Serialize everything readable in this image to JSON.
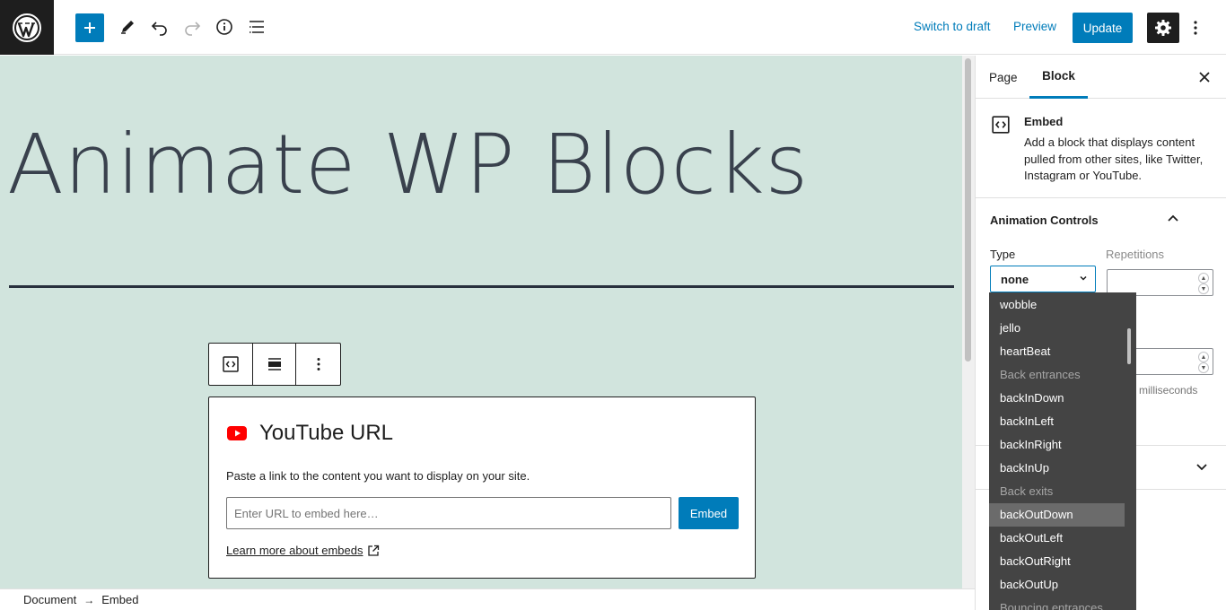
{
  "topbar": {
    "switch_to_draft": "Switch to draft",
    "preview": "Preview",
    "update": "Update"
  },
  "canvas": {
    "title": "Animate WP Blocks"
  },
  "embed": {
    "title": "YouTube URL",
    "instructions": "Paste a link to the content you want to display on your site.",
    "placeholder": "Enter URL to embed here…",
    "button": "Embed",
    "learn_more": "Learn more about embeds"
  },
  "footer": {
    "breadcrumb": [
      "Document",
      "Embed"
    ]
  },
  "sidebar": {
    "tabs": [
      "Page",
      "Block"
    ],
    "block_card": {
      "title": "Embed",
      "description": "Add a block that displays content pulled from other sites, like Twitter, Instagram or YouTube."
    },
    "animation_controls": {
      "heading": "Animation Controls",
      "type_label": "Type",
      "type_value": "none",
      "repetitions_label": "Repetitions",
      "duration_help": "n milliseconds"
    }
  },
  "dropdown": {
    "options": [
      {
        "label": "wobble",
        "kind": "option"
      },
      {
        "label": "jello",
        "kind": "option"
      },
      {
        "label": "heartBeat",
        "kind": "option"
      },
      {
        "label": "Back entrances",
        "kind": "group"
      },
      {
        "label": "backInDown",
        "kind": "option"
      },
      {
        "label": "backInLeft",
        "kind": "option"
      },
      {
        "label": "backInRight",
        "kind": "option"
      },
      {
        "label": "backInUp",
        "kind": "option"
      },
      {
        "label": "Back exits",
        "kind": "group"
      },
      {
        "label": "backOutDown",
        "kind": "option",
        "highlighted": true
      },
      {
        "label": "backOutLeft",
        "kind": "option"
      },
      {
        "label": "backOutRight",
        "kind": "option"
      },
      {
        "label": "backOutUp",
        "kind": "option"
      },
      {
        "label": "Bouncing entrances",
        "kind": "group"
      }
    ]
  },
  "colors": {
    "accent": "#007cba",
    "canvas_bg": "#d1e4dd",
    "dark": "#1e1e1e",
    "youtube_red": "#ff0000"
  }
}
